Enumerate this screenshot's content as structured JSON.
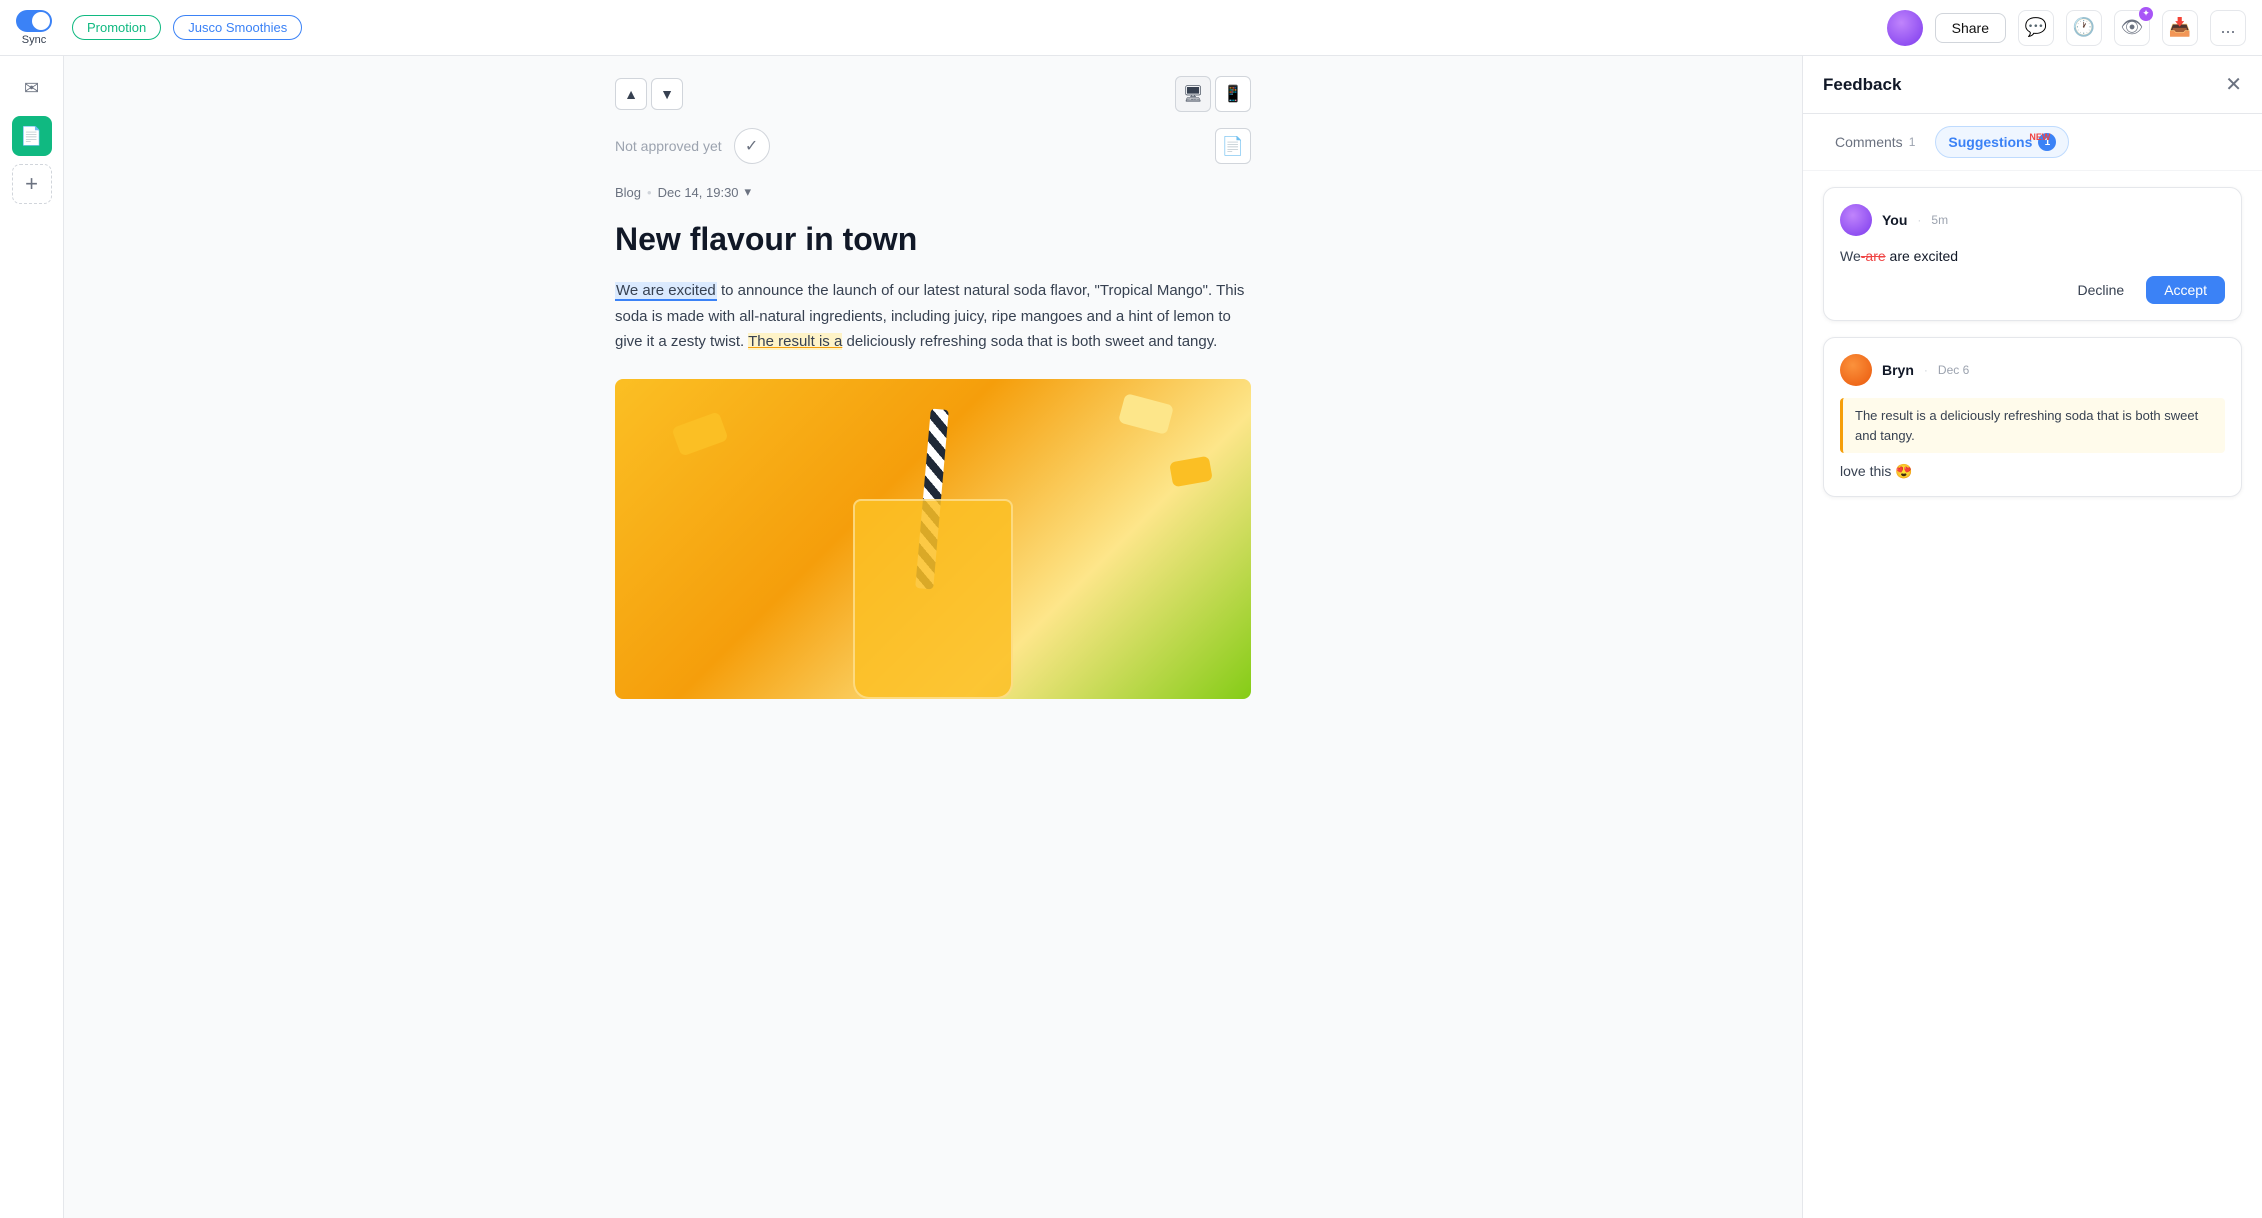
{
  "topbar": {
    "sync_label": "Sync",
    "promotion_tag": "Promotion",
    "project_tag": "Jusco Smoothies",
    "share_label": "Share",
    "more_options": "..."
  },
  "sidebar": {
    "items": [
      {
        "id": "mail",
        "icon": "✉",
        "active": false
      },
      {
        "id": "doc",
        "icon": "📄",
        "active": true
      },
      {
        "id": "add",
        "icon": "+",
        "active": false
      }
    ]
  },
  "content": {
    "approval_status": "Not approved yet",
    "blog_label": "Blog",
    "blog_date": "Dec 14, 19:30",
    "article_title": "New flavour in town",
    "article_body_1": "We are excited",
    "article_body_2": " to announce the launch of our latest natural soda flavor, \"Tropical Mango\". This soda is made with all-natural ingredients, including juicy, ripe mangoes and a hint of lemon to give it a zesty twist. ",
    "article_body_3": "The result is a",
    "article_body_4": " deliciously refreshing soda that is both sweet and tangy."
  },
  "feedback": {
    "title": "Feedback",
    "tabs": [
      {
        "id": "comments",
        "label": "Comments",
        "count": "1",
        "active": false
      },
      {
        "id": "suggestions",
        "label": "Suggestions",
        "count": "1",
        "active": true,
        "new_badge": "NEW"
      }
    ],
    "suggestion": {
      "user": "You",
      "time": "5m",
      "text_before": "We",
      "text_deleted": "-are",
      "text_after": " are excited",
      "decline_label": "Decline",
      "accept_label": "Accept"
    },
    "comment": {
      "user": "Bryn",
      "date": "Dec 6",
      "quoted": "The result is a deliciously refreshing soda that is both sweet and tangy.",
      "body": "love this 😍"
    }
  }
}
